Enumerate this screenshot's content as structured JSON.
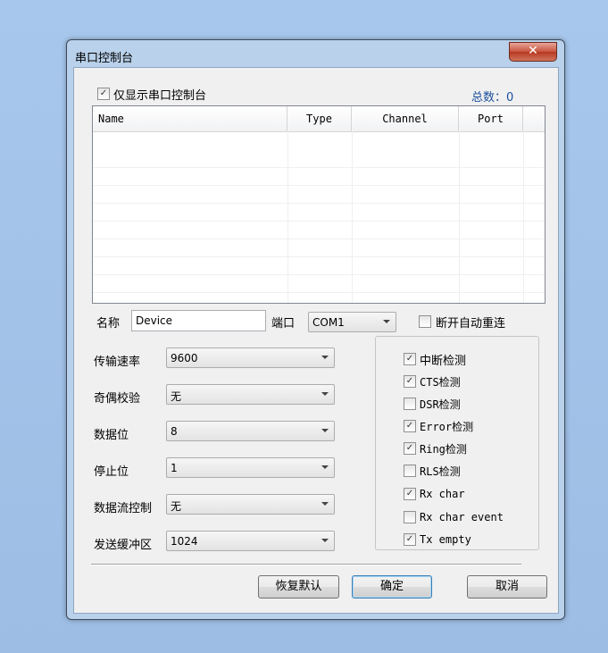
{
  "window": {
    "title": "串口控制台",
    "close_glyph": "✕"
  },
  "only_serial": {
    "label": "仅显示串口控制台",
    "checked": true
  },
  "total": {
    "label": "总数：",
    "value": "0"
  },
  "list": {
    "columns": [
      "Name",
      "Type",
      "Channel",
      "Port"
    ],
    "rows": []
  },
  "name_field": {
    "label": "名称",
    "value": "Device"
  },
  "port_field": {
    "label": "端口",
    "value": "COM1"
  },
  "auto_reconnect": {
    "label": "断开自动重连",
    "checked": false
  },
  "settings": [
    {
      "label": "传输速率",
      "value": "9600"
    },
    {
      "label": "奇偶校验",
      "value": "无"
    },
    {
      "label": "数据位",
      "value": "8"
    },
    {
      "label": "停止位",
      "value": "1"
    },
    {
      "label": "数据流控制",
      "value": "无"
    },
    {
      "label": "发送缓冲区",
      "value": "1024"
    }
  ],
  "detections": [
    {
      "label": "中断检测",
      "checked": true
    },
    {
      "label": "CTS检测",
      "checked": true
    },
    {
      "label": "DSR检测",
      "checked": false
    },
    {
      "label": "Error检测",
      "checked": true
    },
    {
      "label": "Ring检测",
      "checked": true
    },
    {
      "label": "RLS检测",
      "checked": false
    },
    {
      "label": "Rx char",
      "checked": true
    },
    {
      "label": "Rx char event",
      "checked": false
    },
    {
      "label": "Tx empty",
      "checked": true
    }
  ],
  "buttons": {
    "restore": "恢复默认",
    "ok": "确定",
    "cancel": "取消"
  },
  "check_glyph": "✓"
}
